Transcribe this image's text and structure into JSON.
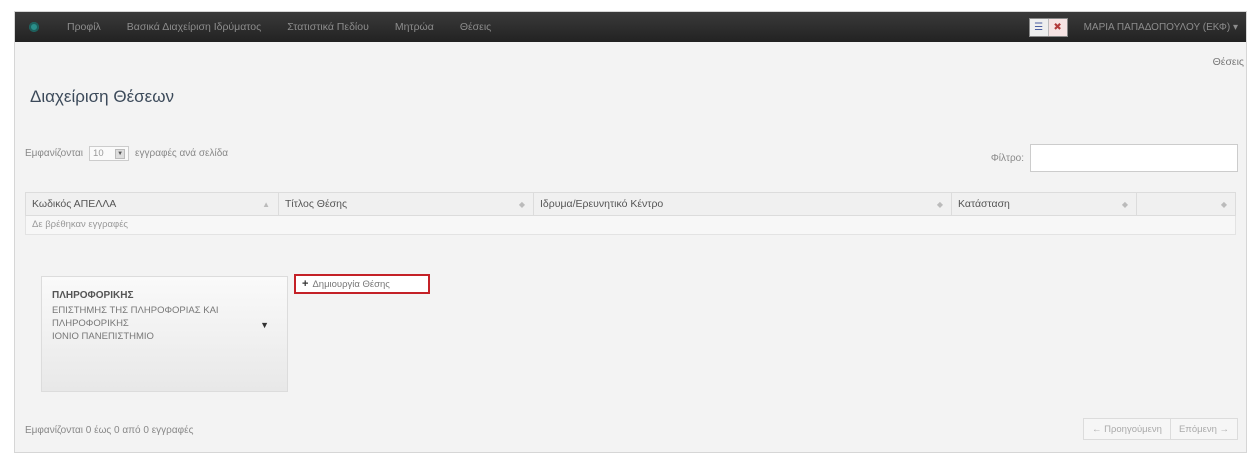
{
  "navbar": {
    "items": [
      "Προφίλ",
      "Βασικά Διαχείριση Ιδρύματος",
      "Στατιστικά Πεδίου",
      "Μητρώα",
      "Θέσεις"
    ],
    "lang": {
      "en": "☰",
      "gr": "✖"
    },
    "user": "ΜΑΡΙΑ ΠΑΠΑΔΟΠΟΥΛΟΥ (ΕΚΦ)"
  },
  "page": {
    "title": "Διαχείριση Θέσεων",
    "crumb": "Θέσεις"
  },
  "table_controls": {
    "len_prefix": "Εμφανίζονται",
    "len_value": "10",
    "len_suffix": "εγγραφές ανά σελίδα",
    "filter_label": "Φίλτρο:",
    "filter_value": ""
  },
  "table": {
    "columns": [
      "Κωδικός ΑΠΕΛΛΑ",
      "Τίτλος Θέσης",
      "Ιδρυμα/Ερευνητικό Κέντρο",
      "Κατάσταση",
      ""
    ],
    "empty_text": "Δε βρέθηκαν εγγραφές"
  },
  "card": {
    "title": "ΠΛΗΡΟΦΟΡΙΚΗΣ",
    "line1": "ΕΠΙΣΤΗΜΗΣ ΤΗΣ ΠΛΗΡΟΦΟΡΙΑΣ ΚΑΙ",
    "line2": "ΠΛΗΡΟΦΟΡΙΚΗΣ",
    "line3": "ΙΟΝΙΟ ΠΑΝΕΠΙΣΤΗΜΙΟ"
  },
  "actions": {
    "create_label": "Δημιουργία Θέσης"
  },
  "footer": {
    "info": "Εμφανίζονται 0 έως 0 από 0 εγγραφές",
    "prev": "← Προηγούμενη",
    "next": "Επόμενη →"
  },
  "colors": {
    "navbar": "#2b2b2b",
    "highlight": "#c42127",
    "title": "#3c4a5a"
  }
}
